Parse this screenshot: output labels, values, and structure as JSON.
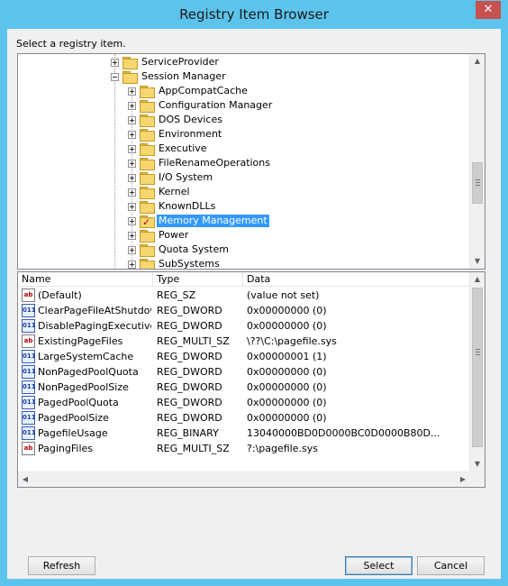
{
  "window": {
    "title": "Registry Item Browser",
    "close_glyph": "✕"
  },
  "prompt": "Select a registry item.",
  "tree": {
    "items": [
      {
        "label": "ServiceProvider",
        "depth": 0,
        "expander": "plus"
      },
      {
        "label": "Session Manager",
        "depth": 0,
        "expander": "minus"
      },
      {
        "label": "AppCompatCache",
        "depth": 1,
        "expander": "plus"
      },
      {
        "label": "Configuration Manager",
        "depth": 1,
        "expander": "plus"
      },
      {
        "label": "DOS Devices",
        "depth": 1,
        "expander": "plus"
      },
      {
        "label": "Environment",
        "depth": 1,
        "expander": "plus"
      },
      {
        "label": "Executive",
        "depth": 1,
        "expander": "plus"
      },
      {
        "label": "FileRenameOperations",
        "depth": 1,
        "expander": "plus"
      },
      {
        "label": "I/O System",
        "depth": 1,
        "expander": "plus"
      },
      {
        "label": "Kernel",
        "depth": 1,
        "expander": "plus"
      },
      {
        "label": "KnownDLLs",
        "depth": 1,
        "expander": "plus"
      },
      {
        "label": "Memory Management",
        "depth": 1,
        "expander": "plus",
        "selected": true,
        "checked": true
      },
      {
        "label": "Power",
        "depth": 1,
        "expander": "plus"
      },
      {
        "label": "Quota System",
        "depth": 1,
        "expander": "plus"
      },
      {
        "label": "SubSystems",
        "depth": 1,
        "expander": "plus"
      }
    ]
  },
  "values_list": {
    "columns": [
      "Name",
      "Type",
      "Data"
    ],
    "rows": [
      {
        "icon": "string-value-icon",
        "icon_text": "ab",
        "name": "(Default)",
        "type": "REG_SZ",
        "data": "(value not set)"
      },
      {
        "icon": "binary-value-icon",
        "icon_text": "011",
        "name": "ClearPageFileAtShutdown",
        "type": "REG_DWORD",
        "data": "0x00000000 (0)"
      },
      {
        "icon": "binary-value-icon",
        "icon_text": "011",
        "name": "DisablePagingExecutive",
        "type": "REG_DWORD",
        "data": "0x00000000 (0)"
      },
      {
        "icon": "string-value-icon",
        "icon_text": "ab",
        "name": "ExistingPageFiles",
        "type": "REG_MULTI_SZ",
        "data": "\\??\\C:\\pagefile.sys"
      },
      {
        "icon": "binary-value-icon",
        "icon_text": "011",
        "name": "LargeSystemCache",
        "type": "REG_DWORD",
        "data": "0x00000001 (1)"
      },
      {
        "icon": "binary-value-icon",
        "icon_text": "011",
        "name": "NonPagedPoolQuota",
        "type": "REG_DWORD",
        "data": "0x00000000 (0)"
      },
      {
        "icon": "binary-value-icon",
        "icon_text": "011",
        "name": "NonPagedPoolSize",
        "type": "REG_DWORD",
        "data": "0x00000000 (0)"
      },
      {
        "icon": "binary-value-icon",
        "icon_text": "011",
        "name": "PagedPoolQuota",
        "type": "REG_DWORD",
        "data": "0x00000000 (0)"
      },
      {
        "icon": "binary-value-icon",
        "icon_text": "011",
        "name": "PagedPoolSize",
        "type": "REG_DWORD",
        "data": "0x00000000 (0)"
      },
      {
        "icon": "binary-value-icon",
        "icon_text": "011",
        "name": "PagefileUsage",
        "type": "REG_BINARY",
        "data": "13040000BD0D0000BC0D0000B80D..."
      },
      {
        "icon": "string-value-icon",
        "icon_text": "ab",
        "name": "PagingFiles",
        "type": "REG_MULTI_SZ",
        "data": "?:\\pagefile.sys"
      }
    ]
  },
  "buttons": {
    "refresh": "Refresh",
    "select": "Select",
    "cancel": "Cancel"
  },
  "colors": {
    "window_frame": "#5cc4ec",
    "selection": "#3399ff",
    "close_button": "#c75050"
  }
}
